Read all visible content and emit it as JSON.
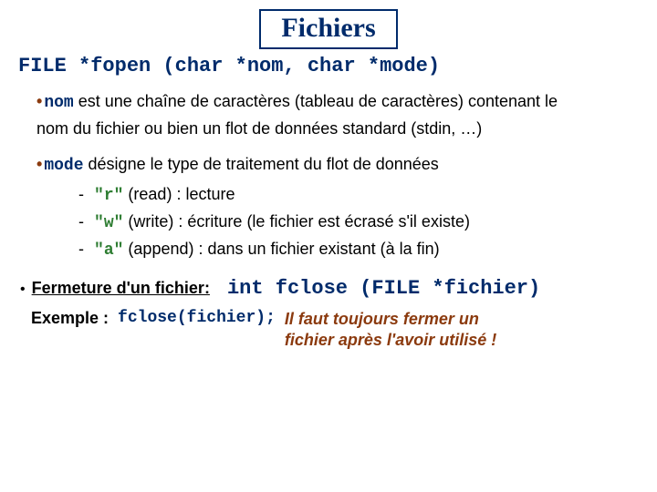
{
  "title": "Fichiers",
  "signature": "FILE *fopen (char *nom, char *mode)",
  "bullets": {
    "nom": {
      "kw": "nom",
      "text1": " est une chaîne de caractères (tableau de caractères) contenant le",
      "text2": "nom du fichier ou bien un flot de données standard (stdin, …)"
    },
    "mode": {
      "kw": "mode",
      "text": " désigne le type de traitement du flot de données"
    }
  },
  "modes": [
    {
      "kw": "\"r\"",
      "desc": " (read) : lecture"
    },
    {
      "kw": "\"w\"",
      "desc": " (write) : écriture (le fichier est écrasé s'il existe)"
    },
    {
      "kw": "\"a\"",
      "desc": " (append) : dans un fichier existant (à la fin)"
    }
  ],
  "close": {
    "label": "Fermeture d'un fichier:",
    "sig": "int fclose (FILE *fichier)"
  },
  "example": {
    "label": "Exemple :",
    "code": "fclose(fichier);",
    "note1": "Il faut toujours fermer un",
    "note2": "fichier après l'avoir utilisé !"
  }
}
